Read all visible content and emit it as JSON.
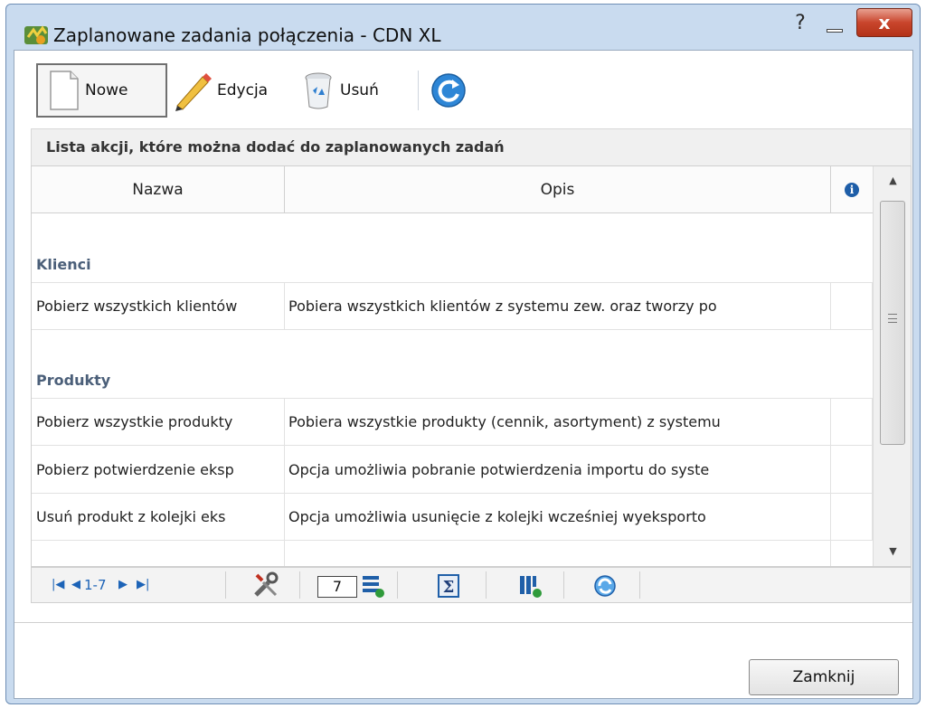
{
  "window": {
    "title": "Zaplanowane zadania połączenia - CDN XL",
    "help_glyph": "?",
    "close_glyph": "x"
  },
  "toolbar": {
    "new_label": "Nowe",
    "edit_label": "Edycja",
    "delete_label": "Usuń"
  },
  "section": {
    "header": "Lista akcji, które można dodać do zaplanowanych zadań"
  },
  "grid": {
    "columns": [
      "Nazwa",
      "Opis"
    ],
    "info_glyph": "i",
    "groups": [
      {
        "label": "Klienci",
        "rows": [
          {
            "name": "Pobierz wszystkich klientów",
            "desc": "Pobiera wszystkich klientów z systemu zew. oraz tworzy po"
          }
        ]
      },
      {
        "label": "Produkty",
        "rows": [
          {
            "name": "Pobierz wszystkie produkty",
            "desc": "Pobiera wszystkie produkty (cennik, asortyment) z systemu"
          },
          {
            "name": "Pobierz potwierdzenie eksp",
            "desc": "Opcja umożliwia pobranie potwierdzenia importu do syste"
          },
          {
            "name": "Usuń produkt z kolejki eks",
            "desc": "Opcja umożliwia usunięcie z kolejki wcześniej wyeksporto"
          }
        ]
      }
    ]
  },
  "pager": {
    "range": "1-7",
    "page_size": "7"
  },
  "footer": {
    "close_label": "Zamknij"
  },
  "colors": {
    "window_frame": "#c9dbef",
    "close_red": "#c9452c",
    "group_label": "#4b5f79",
    "link_blue": "#1c63b7"
  }
}
